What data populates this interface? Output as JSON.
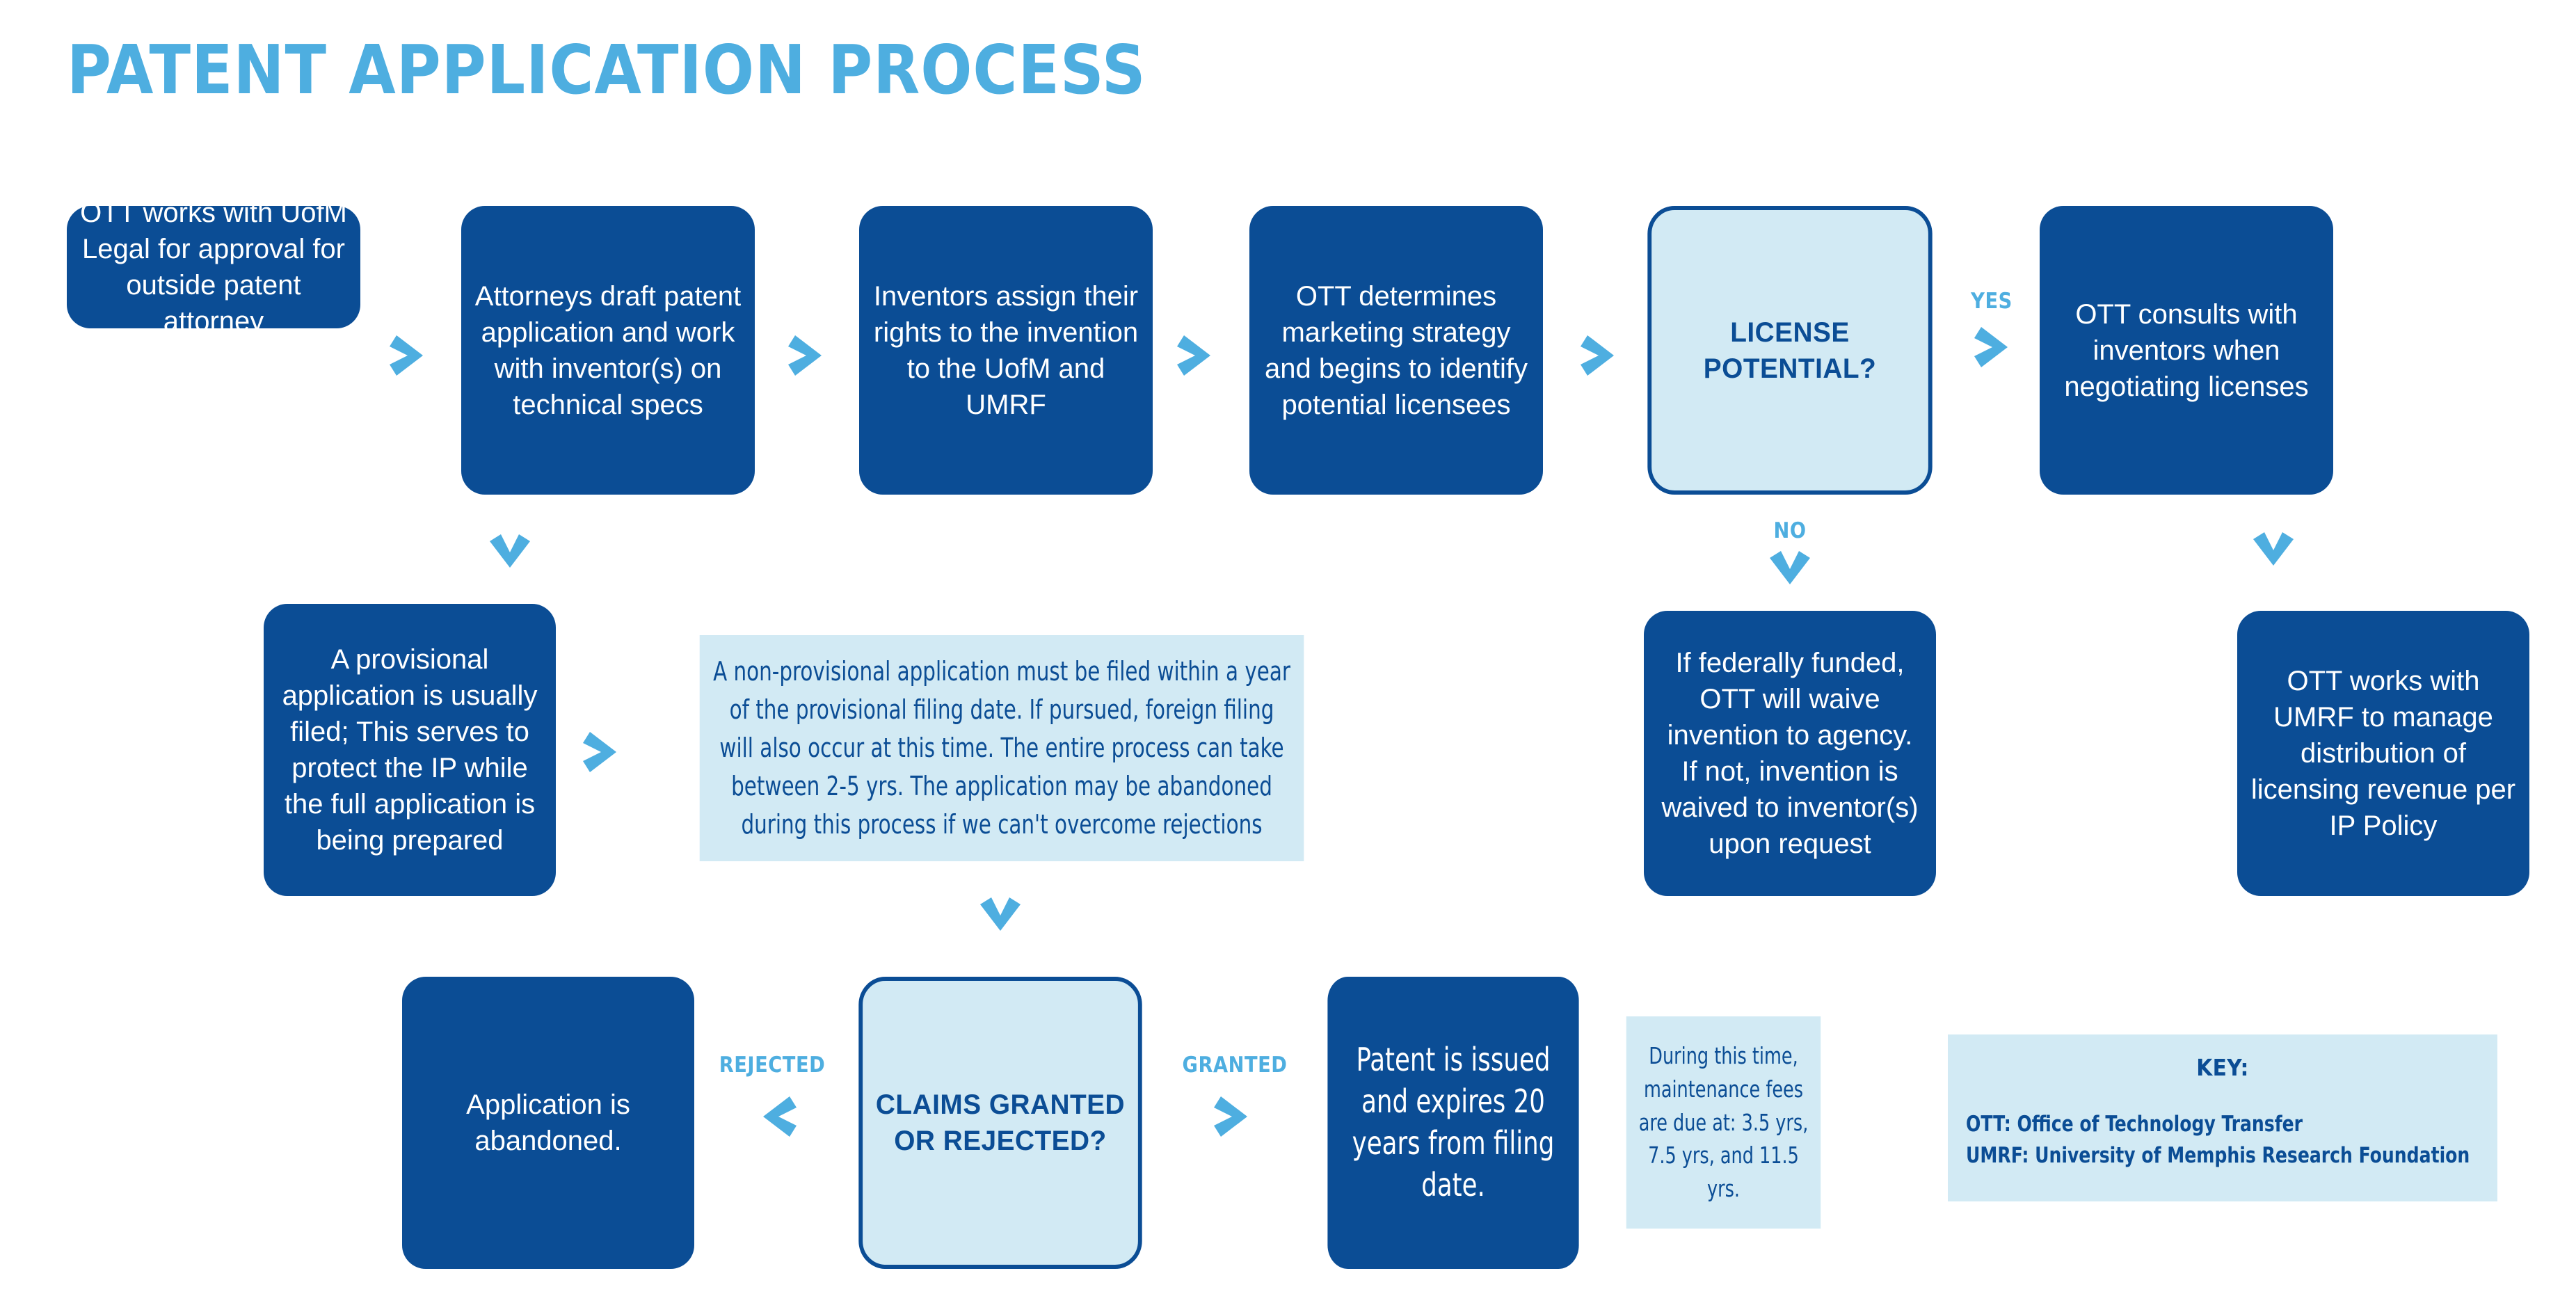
{
  "title": "PATENT APPLICATION PROCESS",
  "colors": {
    "dark_blue": "#0b4d95",
    "light_blue_fill": "#d2eaf4",
    "accent_blue": "#4eaee0",
    "white": "#ffffff"
  },
  "nodes": {
    "step1": "OTT works with UofM Legal for approval for outside patent attorney",
    "step2": "Attorneys draft patent application and work with inventor(s) on technical specs",
    "step3": "Inventors assign their rights to the invention to the UofM and UMRF",
    "step4": "OTT determines marketing strategy and begins to identify potential licensees",
    "decision_license": "LICENSE POTENTIAL?",
    "step5_yes": "OTT consults with inventors when negotiating licenses",
    "provisional": "A provisional application is usually filed; This serves to protect the IP while the full application is being prepared",
    "nonprovisional": "A non-provisional application must be filed within a year of the provisional filing date. If pursued, foreign filing will also occur at this time. The entire process can take between 2-5 yrs. The application may be abandoned during this process if we can't overcome rejections",
    "federally_funded": "If federally funded, OTT will waive invention to agency. If not, invention is waived to inventor(s) upon request",
    "umrf_revenue": "OTT works with UMRF to manage distribution of licensing revenue per IP Policy",
    "abandoned": "Application is abandoned.",
    "decision_claims": "CLAIMS GRANTED OR REJECTED?",
    "patent_issued": "Patent is issued and expires 20 years from filing date.",
    "maintenance_fees": "During this time, maintenance fees are due at: 3.5 yrs, 7.5 yrs, and 11.5 yrs."
  },
  "branch_labels": {
    "yes": "YES",
    "no": "NO",
    "rejected": "REJECTED",
    "granted": "GRANTED"
  },
  "key": {
    "title": "KEY:",
    "line1": "OTT: Office of Technology Transfer",
    "line2": "UMRF: University of Memphis Research Foundation"
  }
}
